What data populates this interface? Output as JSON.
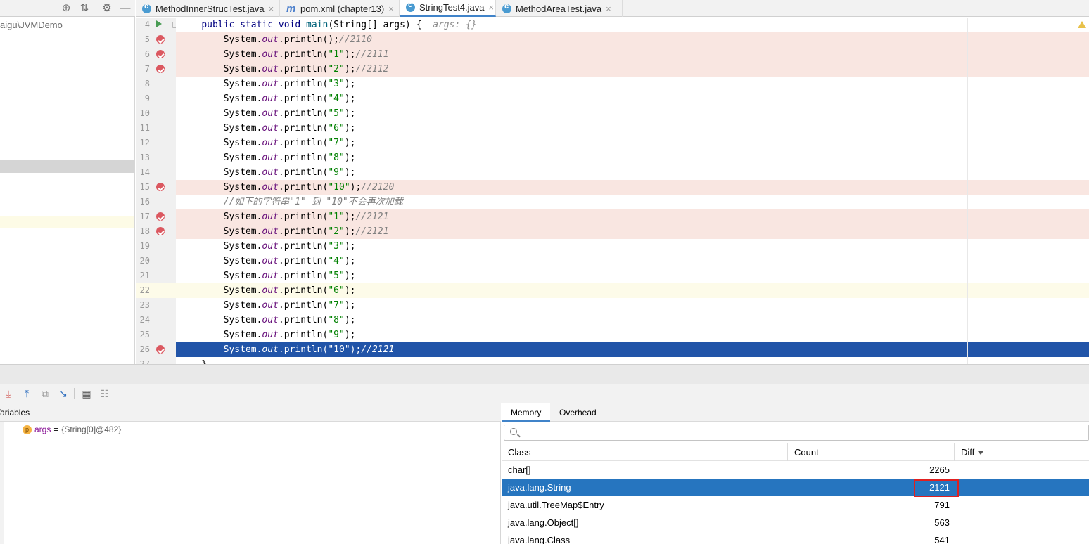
{
  "project": {
    "path_label": "aigu\\JVMDemo"
  },
  "tabs": [
    {
      "label": "MethodInnerStrucTest.java",
      "icon": "java-class-icon",
      "active": false
    },
    {
      "label": "pom.xml (chapter13)",
      "icon": "maven-icon",
      "active": false
    },
    {
      "label": "StringTest4.java",
      "icon": "java-class-icon",
      "active": true
    },
    {
      "label": "MethodAreaTest.java",
      "icon": "java-class-icon",
      "active": false
    }
  ],
  "editor": {
    "lines": [
      {
        "num": "4",
        "code": [
          {
            "t": "    "
          },
          {
            "t": "public static void ",
            "c": "kw"
          },
          {
            "t": "main",
            "c": "fn"
          },
          {
            "t": "(String[] args) {  "
          },
          {
            "t": "args: {}",
            "c": "hint"
          }
        ],
        "marker": "run",
        "hl": "none"
      },
      {
        "num": "5",
        "code": [
          {
            "t": "        System."
          },
          {
            "t": "out",
            "c": "fld"
          },
          {
            "t": ".println();"
          },
          {
            "t": "//2110",
            "c": "cmt"
          }
        ],
        "marker": "bp",
        "hl": "bp"
      },
      {
        "num": "6",
        "code": [
          {
            "t": "        System."
          },
          {
            "t": "out",
            "c": "fld"
          },
          {
            "t": ".println("
          },
          {
            "t": "\"1\"",
            "c": "str"
          },
          {
            "t": ");"
          },
          {
            "t": "//2111",
            "c": "cmt"
          }
        ],
        "marker": "bp",
        "hl": "bp"
      },
      {
        "num": "7",
        "code": [
          {
            "t": "        System."
          },
          {
            "t": "out",
            "c": "fld"
          },
          {
            "t": ".println("
          },
          {
            "t": "\"2\"",
            "c": "str"
          },
          {
            "t": ");"
          },
          {
            "t": "//2112",
            "c": "cmt"
          }
        ],
        "marker": "bp",
        "hl": "bp"
      },
      {
        "num": "8",
        "code": [
          {
            "t": "        System."
          },
          {
            "t": "out",
            "c": "fld"
          },
          {
            "t": ".println("
          },
          {
            "t": "\"3\"",
            "c": "str"
          },
          {
            "t": ");"
          }
        ],
        "marker": "",
        "hl": "none"
      },
      {
        "num": "9",
        "code": [
          {
            "t": "        System."
          },
          {
            "t": "out",
            "c": "fld"
          },
          {
            "t": ".println("
          },
          {
            "t": "\"4\"",
            "c": "str"
          },
          {
            "t": ");"
          }
        ],
        "marker": "",
        "hl": "none"
      },
      {
        "num": "10",
        "code": [
          {
            "t": "        System."
          },
          {
            "t": "out",
            "c": "fld"
          },
          {
            "t": ".println("
          },
          {
            "t": "\"5\"",
            "c": "str"
          },
          {
            "t": ");"
          }
        ],
        "marker": "",
        "hl": "none"
      },
      {
        "num": "11",
        "code": [
          {
            "t": "        System."
          },
          {
            "t": "out",
            "c": "fld"
          },
          {
            "t": ".println("
          },
          {
            "t": "\"6\"",
            "c": "str"
          },
          {
            "t": ");"
          }
        ],
        "marker": "",
        "hl": "none"
      },
      {
        "num": "12",
        "code": [
          {
            "t": "        System."
          },
          {
            "t": "out",
            "c": "fld"
          },
          {
            "t": ".println("
          },
          {
            "t": "\"7\"",
            "c": "str"
          },
          {
            "t": ");"
          }
        ],
        "marker": "",
        "hl": "none"
      },
      {
        "num": "13",
        "code": [
          {
            "t": "        System."
          },
          {
            "t": "out",
            "c": "fld"
          },
          {
            "t": ".println("
          },
          {
            "t": "\"8\"",
            "c": "str"
          },
          {
            "t": ");"
          }
        ],
        "marker": "",
        "hl": "none"
      },
      {
        "num": "14",
        "code": [
          {
            "t": "        System."
          },
          {
            "t": "out",
            "c": "fld"
          },
          {
            "t": ".println("
          },
          {
            "t": "\"9\"",
            "c": "str"
          },
          {
            "t": ");"
          }
        ],
        "marker": "",
        "hl": "none"
      },
      {
        "num": "15",
        "code": [
          {
            "t": "        System."
          },
          {
            "t": "out",
            "c": "fld"
          },
          {
            "t": ".println("
          },
          {
            "t": "\"10\"",
            "c": "str"
          },
          {
            "t": ");"
          },
          {
            "t": "//2120",
            "c": "cmt"
          }
        ],
        "marker": "bp",
        "hl": "bp"
      },
      {
        "num": "16",
        "code": [
          {
            "t": "        "
          },
          {
            "t": "//如下的字符串\"1\" 到 \"10\"不会再次加载",
            "c": "cmt"
          }
        ],
        "marker": "",
        "hl": "none"
      },
      {
        "num": "17",
        "code": [
          {
            "t": "        System."
          },
          {
            "t": "out",
            "c": "fld"
          },
          {
            "t": ".println("
          },
          {
            "t": "\"1\"",
            "c": "str"
          },
          {
            "t": ");"
          },
          {
            "t": "//2121",
            "c": "cmt"
          }
        ],
        "marker": "bp",
        "hl": "bp"
      },
      {
        "num": "18",
        "code": [
          {
            "t": "        System."
          },
          {
            "t": "out",
            "c": "fld"
          },
          {
            "t": ".println("
          },
          {
            "t": "\"2\"",
            "c": "str"
          },
          {
            "t": ");"
          },
          {
            "t": "//2121",
            "c": "cmt"
          }
        ],
        "marker": "bp",
        "hl": "bp"
      },
      {
        "num": "19",
        "code": [
          {
            "t": "        System."
          },
          {
            "t": "out",
            "c": "fld"
          },
          {
            "t": ".println("
          },
          {
            "t": "\"3\"",
            "c": "str"
          },
          {
            "t": ");"
          }
        ],
        "marker": "",
        "hl": "none"
      },
      {
        "num": "20",
        "code": [
          {
            "t": "        System."
          },
          {
            "t": "out",
            "c": "fld"
          },
          {
            "t": ".println("
          },
          {
            "t": "\"4\"",
            "c": "str"
          },
          {
            "t": ");"
          }
        ],
        "marker": "",
        "hl": "none"
      },
      {
        "num": "21",
        "code": [
          {
            "t": "        System."
          },
          {
            "t": "out",
            "c": "fld"
          },
          {
            "t": ".println("
          },
          {
            "t": "\"5\"",
            "c": "str"
          },
          {
            "t": ");"
          }
        ],
        "marker": "",
        "hl": "none"
      },
      {
        "num": "22",
        "code": [
          {
            "t": "        System."
          },
          {
            "t": "out",
            "c": "fld"
          },
          {
            "t": ".println("
          },
          {
            "t": "\"6\"",
            "c": "str"
          },
          {
            "t": ");"
          }
        ],
        "marker": "",
        "hl": "caret"
      },
      {
        "num": "23",
        "code": [
          {
            "t": "        System."
          },
          {
            "t": "out",
            "c": "fld"
          },
          {
            "t": ".println("
          },
          {
            "t": "\"7\"",
            "c": "str"
          },
          {
            "t": ");"
          }
        ],
        "marker": "",
        "hl": "none"
      },
      {
        "num": "24",
        "code": [
          {
            "t": "        System."
          },
          {
            "t": "out",
            "c": "fld"
          },
          {
            "t": ".println("
          },
          {
            "t": "\"8\"",
            "c": "str"
          },
          {
            "t": ");"
          }
        ],
        "marker": "",
        "hl": "none"
      },
      {
        "num": "25",
        "code": [
          {
            "t": "        System."
          },
          {
            "t": "out",
            "c": "fld"
          },
          {
            "t": ".println("
          },
          {
            "t": "\"9\"",
            "c": "str"
          },
          {
            "t": ");"
          }
        ],
        "marker": "",
        "hl": "none"
      },
      {
        "num": "26",
        "code": [
          {
            "t": "        System."
          },
          {
            "t": "out",
            "c": "fld"
          },
          {
            "t": ".println("
          },
          {
            "t": "\"10\"",
            "c": "str"
          },
          {
            "t": ");"
          },
          {
            "t": "//2121",
            "c": "cmt"
          }
        ],
        "marker": "bp",
        "hl": "exec"
      },
      {
        "num": "27",
        "code": [
          {
            "t": "    }"
          }
        ],
        "marker": "",
        "hl": "none"
      }
    ]
  },
  "colors": {
    "breakpoint_line": "#f9e6e1",
    "exec_line": "#2154a8",
    "caret_line": "#fdfbe9",
    "breakpoint_dot": "#db5860",
    "selection": "#2675bf",
    "highlight_box": "#e02020"
  },
  "debug": {
    "toolbar_icons": [
      "step-into-icon",
      "step-out-icon",
      "drop-frame-icon",
      "run-to-cursor-icon",
      "evaluate-expression-icon",
      "trace-icon"
    ],
    "variables": {
      "header": "Variables",
      "items": [
        {
          "badge": "p",
          "name": "args",
          "eq": "=",
          "value": "{String[0]@482}"
        }
      ]
    },
    "memory": {
      "tabs": [
        "Memory",
        "Overhead"
      ],
      "active_tab": "Memory",
      "search_placeholder": "",
      "columns": [
        "Class",
        "Count",
        "Diff"
      ],
      "rows": [
        {
          "class": "char[]",
          "count": "2265",
          "selected": false
        },
        {
          "class": "java.lang.String",
          "count": "2121",
          "selected": true
        },
        {
          "class": "java.util.TreeMap$Entry",
          "count": "791",
          "selected": false
        },
        {
          "class": "java.lang.Object[]",
          "count": "563",
          "selected": false
        },
        {
          "class": "java.lang.Class",
          "count": "541",
          "selected": false
        }
      ]
    }
  }
}
